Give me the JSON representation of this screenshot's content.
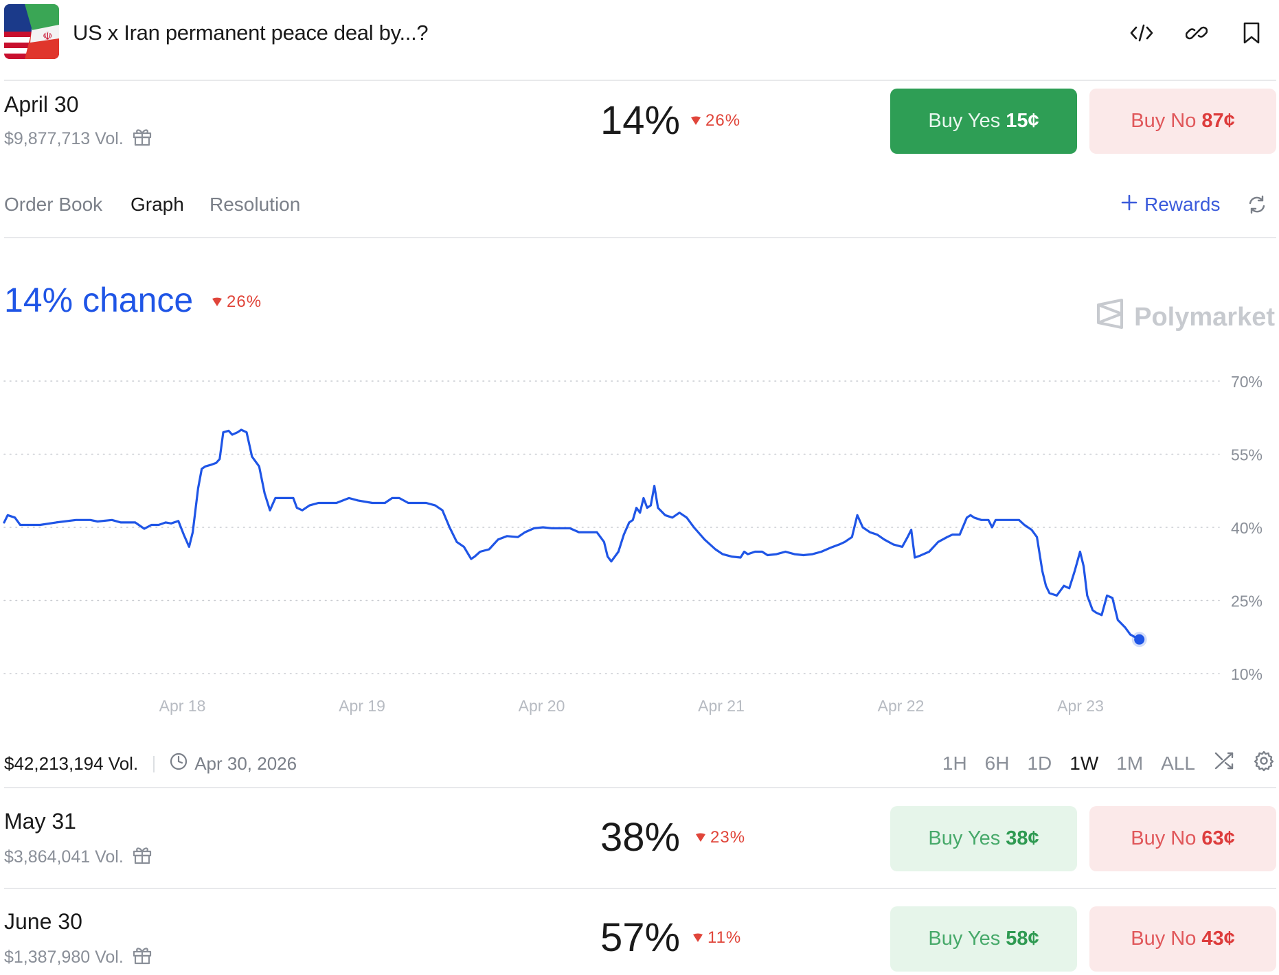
{
  "header": {
    "title": "US x Iran permanent peace deal by...?"
  },
  "outcomes": [
    {
      "date": "April 30",
      "volume": "$9,877,713 Vol.",
      "percent": "14%",
      "change": "26%",
      "yes_label": "Buy Yes",
      "yes_price": "15¢",
      "no_label": "Buy No",
      "no_price": "87¢"
    },
    {
      "date": "May 31",
      "volume": "$3,864,041 Vol.",
      "percent": "38%",
      "change": "23%",
      "yes_label": "Buy Yes",
      "yes_price": "38¢",
      "no_label": "Buy No",
      "no_price": "63¢"
    },
    {
      "date": "June 30",
      "volume": "$1,387,980 Vol.",
      "percent": "57%",
      "change": "11%",
      "yes_label": "Buy Yes",
      "yes_price": "58¢",
      "no_label": "Buy No",
      "no_price": "43¢"
    }
  ],
  "tabs": {
    "order_book": "Order Book",
    "graph": "Graph",
    "resolution": "Resolution",
    "rewards": "Rewards"
  },
  "chart_header": {
    "chance": "14% chance",
    "change": "26%",
    "brand": "Polymarket"
  },
  "footer": {
    "volume": "$42,213,194 Vol.",
    "end_date": "Apr 30, 2026",
    "ranges": [
      "1H",
      "6H",
      "1D",
      "1W",
      "1M",
      "ALL"
    ],
    "active_range": "1W"
  },
  "colors": {
    "line": "#1f55e6",
    "yes": "#2e9e55",
    "no": "#dd3c3c",
    "down": "#e0453a"
  },
  "chart_data": {
    "type": "line",
    "x_ticks": [
      "Apr 18",
      "Apr 19",
      "Apr 20",
      "Apr 21",
      "Apr 22",
      "Apr 23"
    ],
    "y_ticks": [
      "70%",
      "55%",
      "40%",
      "25%",
      "10%"
    ],
    "ylim": [
      10,
      70
    ],
    "grid": true,
    "x_start": 0.0,
    "x_end": 6.32,
    "series": [
      {
        "points": [
          [
            0.0,
            41.0
          ],
          [
            0.02,
            42.5
          ],
          [
            0.06,
            42.0
          ],
          [
            0.09,
            40.5
          ],
          [
            0.2,
            40.5
          ],
          [
            0.29,
            41.0
          ],
          [
            0.4,
            41.5
          ],
          [
            0.48,
            41.5
          ],
          [
            0.52,
            41.2
          ],
          [
            0.6,
            41.5
          ],
          [
            0.65,
            41.0
          ],
          [
            0.73,
            41.0
          ],
          [
            0.78,
            39.7
          ],
          [
            0.82,
            40.5
          ],
          [
            0.86,
            40.5
          ],
          [
            0.9,
            41.0
          ],
          [
            0.93,
            40.8
          ],
          [
            0.97,
            41.3
          ],
          [
            1.0,
            38.5
          ],
          [
            1.03,
            36.0
          ],
          [
            1.05,
            39.0
          ],
          [
            1.08,
            48.0
          ],
          [
            1.1,
            52.0
          ],
          [
            1.12,
            52.5
          ],
          [
            1.15,
            52.8
          ],
          [
            1.18,
            53.2
          ],
          [
            1.2,
            54.0
          ],
          [
            1.22,
            59.5
          ],
          [
            1.25,
            59.8
          ],
          [
            1.27,
            59.0
          ],
          [
            1.3,
            59.5
          ],
          [
            1.32,
            60.0
          ],
          [
            1.35,
            59.5
          ],
          [
            1.38,
            54.5
          ],
          [
            1.42,
            52.5
          ],
          [
            1.45,
            47.0
          ],
          [
            1.48,
            43.5
          ],
          [
            1.51,
            46.0
          ],
          [
            1.55,
            46.0
          ],
          [
            1.61,
            46.0
          ],
          [
            1.63,
            44.0
          ],
          [
            1.66,
            43.5
          ],
          [
            1.7,
            44.5
          ],
          [
            1.75,
            45.0
          ],
          [
            1.85,
            45.0
          ],
          [
            1.92,
            46.0
          ],
          [
            1.97,
            45.5
          ],
          [
            2.05,
            45.0
          ],
          [
            2.12,
            45.0
          ],
          [
            2.16,
            46.0
          ],
          [
            2.2,
            46.0
          ],
          [
            2.25,
            45.0
          ],
          [
            2.35,
            45.0
          ],
          [
            2.4,
            44.5
          ],
          [
            2.44,
            43.5
          ],
          [
            2.48,
            40.0
          ],
          [
            2.52,
            37.0
          ],
          [
            2.56,
            36.0
          ],
          [
            2.6,
            33.5
          ],
          [
            2.62,
            34.0
          ],
          [
            2.65,
            35.0
          ],
          [
            2.7,
            35.5
          ],
          [
            2.75,
            37.5
          ],
          [
            2.8,
            38.2
          ],
          [
            2.86,
            38.0
          ],
          [
            2.9,
            39.0
          ],
          [
            2.95,
            39.8
          ],
          [
            3.0,
            40.0
          ],
          [
            3.05,
            39.8
          ],
          [
            3.15,
            39.8
          ],
          [
            3.2,
            39.0
          ],
          [
            3.3,
            39.0
          ],
          [
            3.34,
            37.0
          ],
          [
            3.36,
            34.0
          ],
          [
            3.38,
            33.0
          ],
          [
            3.42,
            35.0
          ],
          [
            3.45,
            38.5
          ],
          [
            3.48,
            41.0
          ],
          [
            3.5,
            41.5
          ],
          [
            3.52,
            44.0
          ],
          [
            3.54,
            43.0
          ],
          [
            3.56,
            46.0
          ],
          [
            3.58,
            44.0
          ],
          [
            3.6,
            44.5
          ],
          [
            3.62,
            48.5
          ],
          [
            3.64,
            44.0
          ],
          [
            3.68,
            42.5
          ],
          [
            3.72,
            42.0
          ],
          [
            3.76,
            43.0
          ],
          [
            3.8,
            42.0
          ],
          [
            3.84,
            40.0
          ],
          [
            3.9,
            37.5
          ],
          [
            3.96,
            35.5
          ],
          [
            4.0,
            34.5
          ],
          [
            4.05,
            34.0
          ],
          [
            4.1,
            33.8
          ],
          [
            4.12,
            35.0
          ],
          [
            4.14,
            34.5
          ],
          [
            4.18,
            35.0
          ],
          [
            4.22,
            35.0
          ],
          [
            4.25,
            34.3
          ],
          [
            4.3,
            34.5
          ],
          [
            4.35,
            35.0
          ],
          [
            4.4,
            34.5
          ],
          [
            4.45,
            34.3
          ],
          [
            4.5,
            34.5
          ],
          [
            4.55,
            35.0
          ],
          [
            4.6,
            35.8
          ],
          [
            4.65,
            36.5
          ],
          [
            4.68,
            37.0
          ],
          [
            4.72,
            38.0
          ],
          [
            4.75,
            42.5
          ],
          [
            4.78,
            40.0
          ],
          [
            4.82,
            39.0
          ],
          [
            4.86,
            38.5
          ],
          [
            4.9,
            37.5
          ],
          [
            4.95,
            36.5
          ],
          [
            5.0,
            36.0
          ],
          [
            5.03,
            38.0
          ],
          [
            5.05,
            39.5
          ],
          [
            5.07,
            33.8
          ],
          [
            5.1,
            34.2
          ],
          [
            5.15,
            35.0
          ],
          [
            5.2,
            37.0
          ],
          [
            5.25,
            38.0
          ],
          [
            5.28,
            38.5
          ],
          [
            5.32,
            38.5
          ],
          [
            5.36,
            42.0
          ],
          [
            5.38,
            42.5
          ],
          [
            5.4,
            42.0
          ],
          [
            5.44,
            41.5
          ],
          [
            5.48,
            41.5
          ],
          [
            5.5,
            40.0
          ],
          [
            5.52,
            41.5
          ],
          [
            5.56,
            41.5
          ],
          [
            5.65,
            41.5
          ],
          [
            5.68,
            40.5
          ],
          [
            5.72,
            39.5
          ],
          [
            5.75,
            38.0
          ],
          [
            5.78,
            31.0
          ],
          [
            5.8,
            28.0
          ],
          [
            5.82,
            26.5
          ],
          [
            5.86,
            26.0
          ],
          [
            5.9,
            28.0
          ],
          [
            5.93,
            27.5
          ],
          [
            5.96,
            31.0
          ],
          [
            5.99,
            35.0
          ],
          [
            6.01,
            32.0
          ],
          [
            6.03,
            26.0
          ],
          [
            6.06,
            23.0
          ],
          [
            6.08,
            22.5
          ],
          [
            6.11,
            22.0
          ],
          [
            6.14,
            26.0
          ],
          [
            6.17,
            25.5
          ],
          [
            6.2,
            21.0
          ],
          [
            6.24,
            19.5
          ],
          [
            6.27,
            18.0
          ],
          [
            6.32,
            17.0
          ]
        ]
      }
    ]
  }
}
